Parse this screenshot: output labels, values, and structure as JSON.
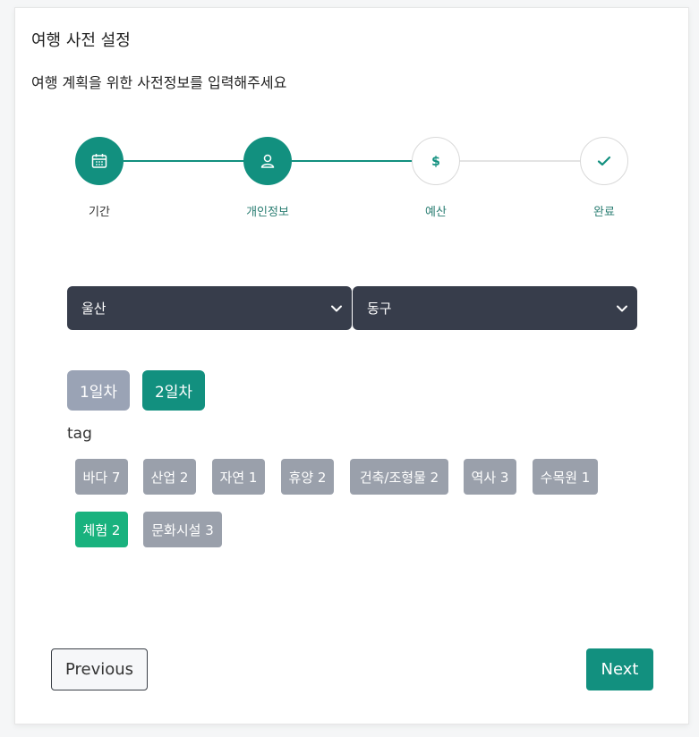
{
  "header": {
    "title": "여행 사전 설정",
    "subtitle": "여행 계획을 위한 사전정보를 입력해주세요"
  },
  "stepper": {
    "steps": [
      {
        "label": "기간",
        "icon": "calendar-icon",
        "state": "completed"
      },
      {
        "label": "개인정보",
        "icon": "user-icon",
        "state": "completed"
      },
      {
        "label": "예산",
        "icon": "dollar-icon",
        "state": "pending"
      },
      {
        "label": "완료",
        "icon": "check-icon",
        "state": "pending"
      }
    ]
  },
  "filters": {
    "region": "울산",
    "district": "동구"
  },
  "days": [
    {
      "label": "1일차",
      "selected": false
    },
    {
      "label": "2일차",
      "selected": true
    }
  ],
  "tags": {
    "heading": "tag",
    "items": [
      {
        "label": "바다 7",
        "active": false
      },
      {
        "label": "산업 2",
        "active": false
      },
      {
        "label": "자연 1",
        "active": false
      },
      {
        "label": "휴양 2",
        "active": false
      },
      {
        "label": "건축/조형물 2",
        "active": false
      },
      {
        "label": "역사 3",
        "active": false
      },
      {
        "label": "수목원 1",
        "active": false
      },
      {
        "label": "체험 2",
        "active": true
      },
      {
        "label": "문화시설 3",
        "active": false
      }
    ]
  },
  "actions": {
    "previous": "Previous",
    "next": "Next"
  },
  "colors": {
    "accent": "#12907f",
    "select_bg": "#373d4b",
    "tag_bg": "#9aa0ab",
    "tag_active": "#19b27e",
    "day_inactive": "#9aa3b5"
  }
}
